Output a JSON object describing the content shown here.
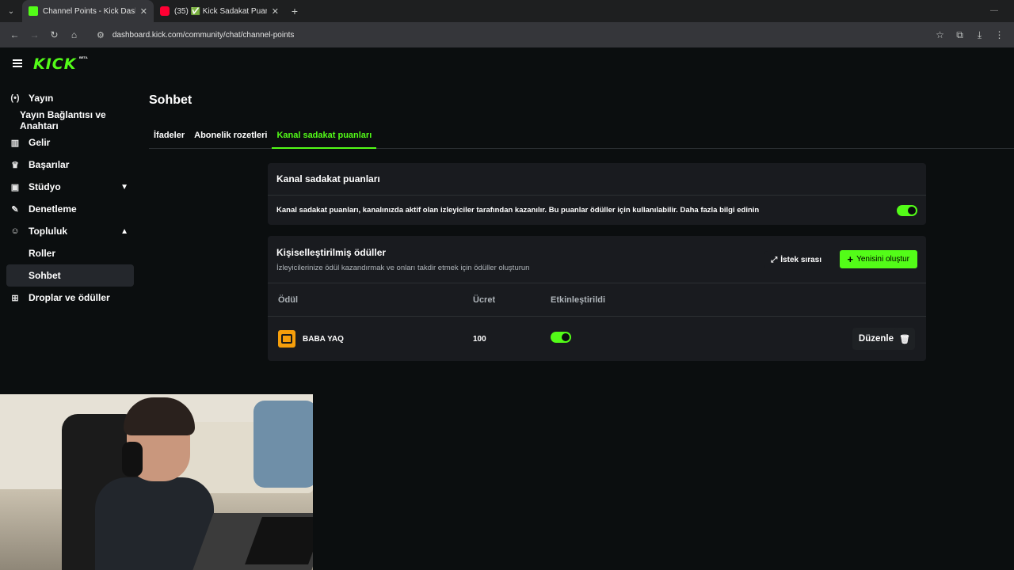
{
  "browser": {
    "tabs": [
      {
        "title": "Channel Points - Kick Dashboar",
        "favicon_color": "#53fc18",
        "active": true
      },
      {
        "title": "(35) ✅ Kick Sadakat Puanı Nası",
        "favicon_color": "#ff0033",
        "active": false
      }
    ],
    "url": "dashboard.kick.com/community/chat/channel-points"
  },
  "app": {
    "logo": "KICK",
    "logo_badge": "BETA",
    "accent": "#53fc18",
    "sidebar": {
      "items": [
        {
          "label": "Yayın",
          "icon": "broadcast-icon"
        },
        {
          "label": "Yayın Bağlantısı ve Anahtarı"
        },
        {
          "label": "Gelir",
          "icon": "chart-icon"
        },
        {
          "label": "Başarılar",
          "icon": "trophy-icon"
        },
        {
          "label": "Stüdyo",
          "icon": "studio-icon"
        },
        {
          "label": "Denetleme",
          "icon": "wrench-icon"
        },
        {
          "label": "Topluluk",
          "icon": "community-icon"
        },
        {
          "label": "Roller"
        },
        {
          "label": "Sohbet"
        },
        {
          "label": "Droplar ve ödüller",
          "icon": "gift-icon"
        }
      ]
    },
    "page_title": "Sohbet",
    "tabs": [
      "İfadeler",
      "Abonelik rozetleri",
      "Kanal sadakat puanları"
    ],
    "active_tab": "Kanal sadakat puanları",
    "loyalty_card": {
      "title": "Kanal sadakat puanları",
      "description": "Kanal sadakat puanları, kanalınızda aktif olan izleyiciler tarafından kazanılır. Bu puanlar ödüller için kullanılabilir. Daha fazla bilgi edinin",
      "enabled": true
    },
    "rewards_card": {
      "title": "Kişiselleştirilmiş ödüller",
      "subtitle": "İzleyicilerinize ödül kazandırmak ve onları takdir etmek için ödüller oluşturun",
      "queue_button": "İstek sırası",
      "new_button": "Yenisini oluştur",
      "columns": [
        "Ödül",
        "Ücret",
        "Etkinleştirildi"
      ],
      "rows": [
        {
          "name": "BABA YAQ",
          "cost": "100",
          "enabled": true,
          "edit_label": "Düzenle"
        }
      ]
    }
  }
}
